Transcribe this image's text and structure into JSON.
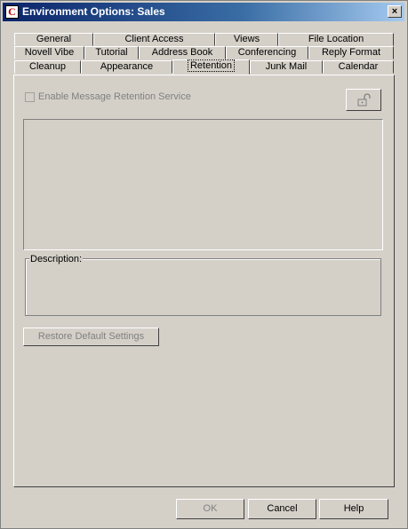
{
  "window": {
    "title": "Environment Options:  Sales",
    "app_icon": "C",
    "close_label": "×"
  },
  "tabs": {
    "row1": [
      "General",
      "Client Access",
      "Views",
      "File Location"
    ],
    "row2": [
      "Novell Vibe",
      "Tutorial",
      "Address Book",
      "Conferencing",
      "Reply Format"
    ],
    "row3": [
      "Cleanup",
      "Appearance",
      "Retention",
      "Junk Mail",
      "Calendar"
    ],
    "active": "Retention"
  },
  "retention": {
    "enable_label": "Enable Message Retention Service",
    "enable_checked": false,
    "lock_icon": "unlock-icon",
    "description_label": "Description:",
    "description_text": "",
    "restore_label": "Restore Default Settings"
  },
  "footer": {
    "ok_label": "OK",
    "cancel_label": "Cancel",
    "help_label": "Help"
  }
}
